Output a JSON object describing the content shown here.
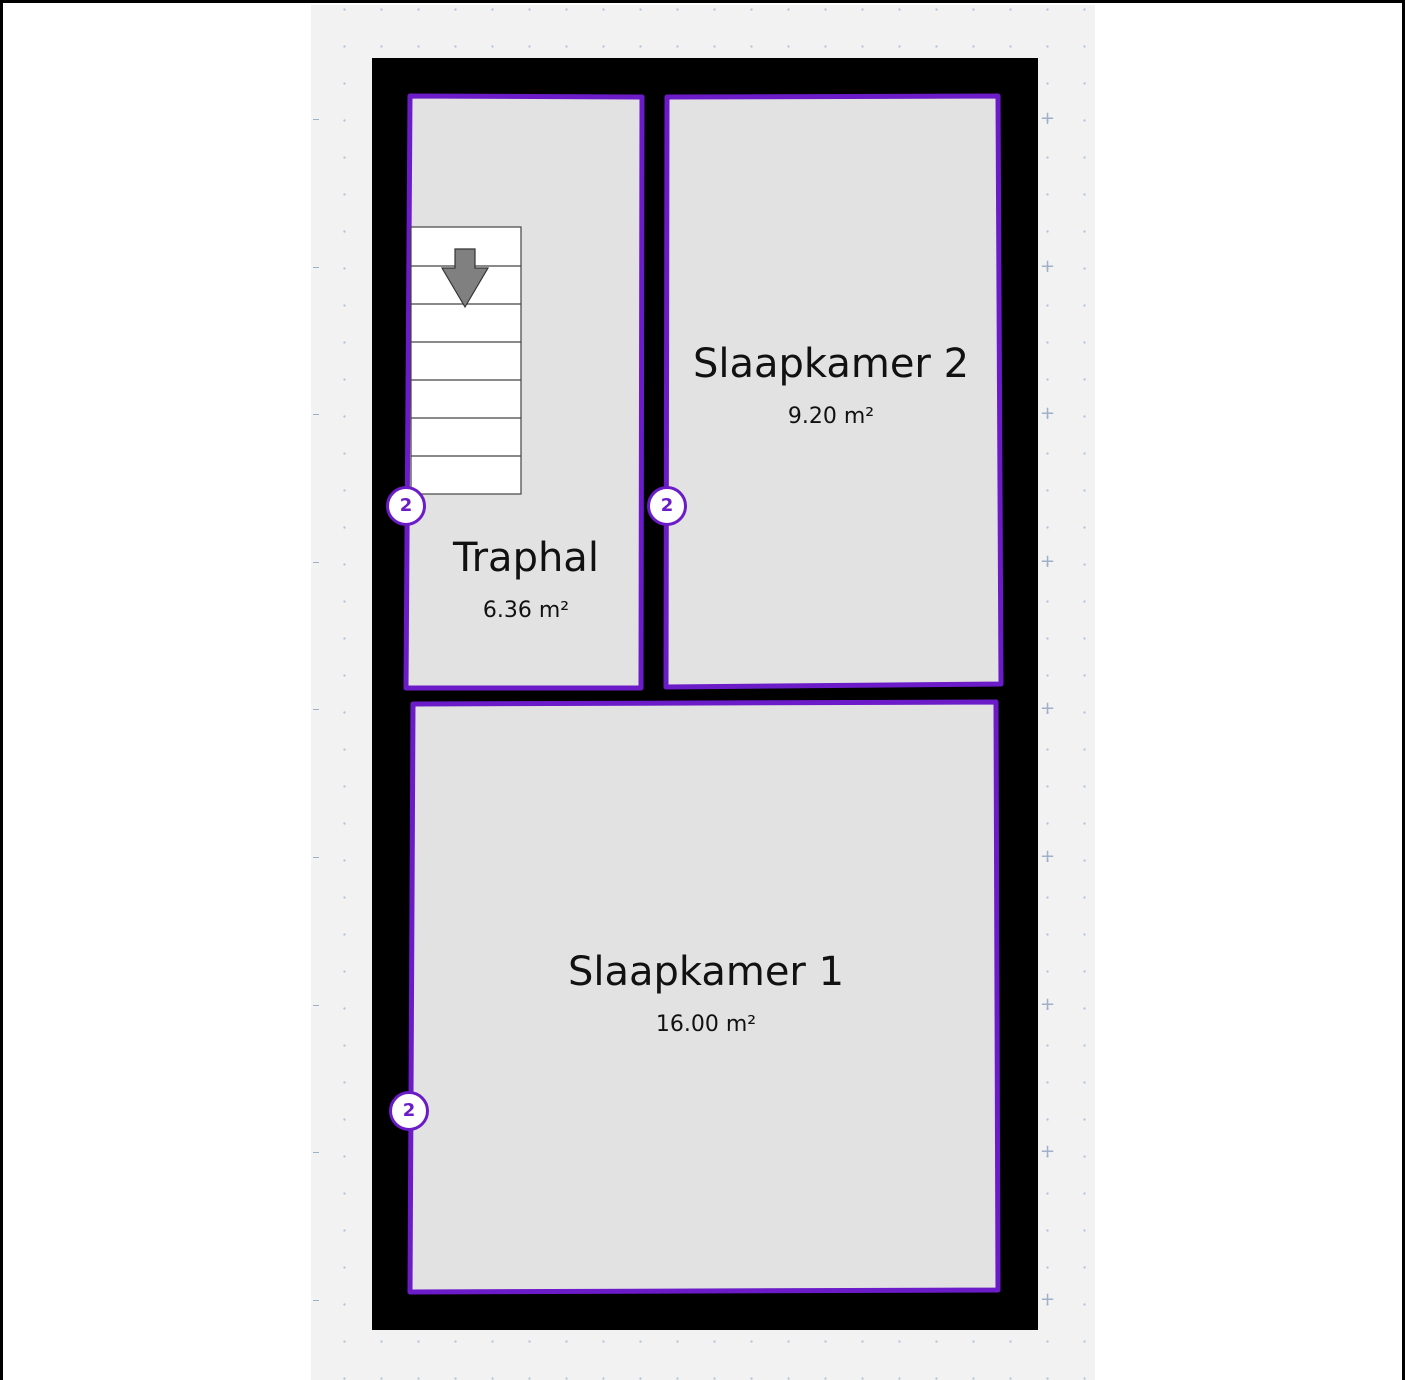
{
  "rooms": {
    "traphal": {
      "name": "Traphal",
      "area": "6.36 m²",
      "badge": "2"
    },
    "slaapkamer2": {
      "name": "Slaapkamer 2",
      "area": "9.20 m²",
      "badge": "2"
    },
    "slaapkamer1": {
      "name": "Slaapkamer 1",
      "area": "16.00 m²",
      "badge": "2"
    }
  },
  "colors": {
    "wall": "#000000",
    "room_fill": "#e2e2e2",
    "room_outline": "#6b1bc8",
    "canvas": "#f2f2f2",
    "grid": "#b9c6d8"
  },
  "icons": {
    "stairs": "stairs-icon",
    "direction": "arrow-down-icon"
  }
}
